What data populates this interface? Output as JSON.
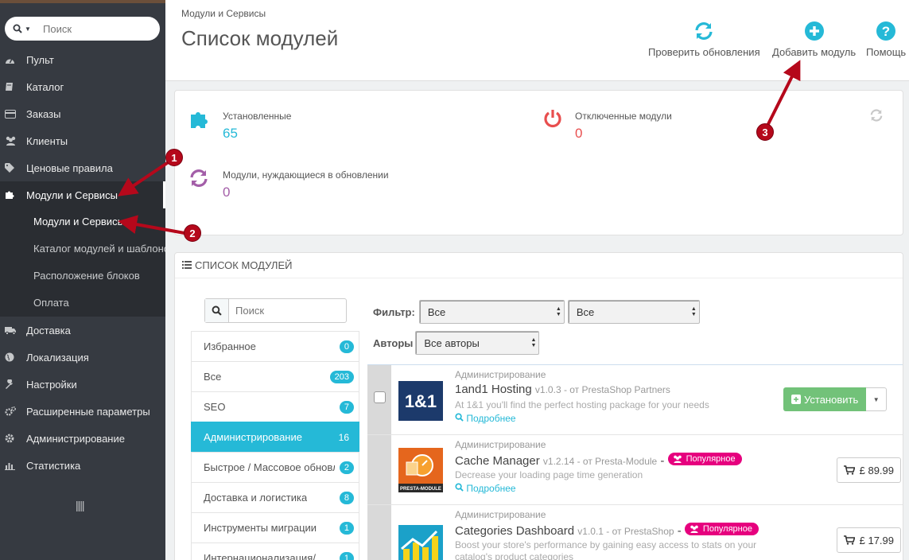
{
  "sidebar": {
    "search_placeholder": "Поиск",
    "items": [
      {
        "label": "Пульт",
        "icon": "dashboard-icon"
      },
      {
        "label": "Каталог",
        "icon": "book-icon"
      },
      {
        "label": "Заказы",
        "icon": "credit-card-icon"
      },
      {
        "label": "Клиенты",
        "icon": "users-icon"
      },
      {
        "label": "Ценовые правила",
        "icon": "tags-icon"
      },
      {
        "label": "Модули и Сервисы",
        "icon": "puzzle-icon"
      }
    ],
    "sub_items": [
      {
        "label": "Модули и Сервисы"
      },
      {
        "label": "Каталог модулей и шаблонов"
      },
      {
        "label": "Расположение блоков"
      },
      {
        "label": "Оплата"
      }
    ],
    "items_after": [
      {
        "label": "Доставка",
        "icon": "truck-icon"
      },
      {
        "label": "Локализация",
        "icon": "globe-icon"
      },
      {
        "label": "Настройки",
        "icon": "wrench-icon"
      },
      {
        "label": "Расширенные параметры",
        "icon": "cogs-icon"
      },
      {
        "label": "Администрирование",
        "icon": "gear-icon"
      },
      {
        "label": "Статистика",
        "icon": "bar-chart-icon"
      }
    ]
  },
  "header": {
    "breadcrumb": "Модули и Сервисы",
    "title": "Список модулей",
    "toolbar": {
      "check_updates": "Проверить обновления",
      "add_module": "Добавить модуль",
      "help": "Помощь"
    }
  },
  "stats": {
    "installed_label": "Установленные",
    "installed_value": "65",
    "disabled_label": "Отключенные модули",
    "disabled_value": "0",
    "updates_label": "Модули, нуждающиеся в обновлении",
    "updates_value": "0"
  },
  "modules_panel": {
    "heading": "Список модулей",
    "search_placeholder": "Поиск",
    "categories": [
      {
        "label": "Избранное",
        "count": "0"
      },
      {
        "label": "Все",
        "count": "203"
      },
      {
        "label": "SEO",
        "count": "7"
      },
      {
        "label": "Администрирование",
        "count": "16"
      },
      {
        "label": "Быстрое / Массовое обновление",
        "count": "2"
      },
      {
        "label": "Доставка и логистика",
        "count": "8"
      },
      {
        "label": "Инструменты миграции",
        "count": "1"
      },
      {
        "label": "Интернационализация/",
        "count": "1"
      }
    ],
    "filter_label": "Фильтр:",
    "filter_value_1": "Все",
    "filter_value_2": "Все",
    "authors_label": "Авторы",
    "authors_value": "Все авторы",
    "modules": [
      {
        "category": "Администрирование",
        "name": "1and1 Hosting",
        "version": "v1.0.3 - от PrestaShop Partners",
        "desc": "At 1&1 you'll find the perfect hosting package for your needs",
        "more": "Подробнее",
        "action": "Установить",
        "logo_text": "1&1"
      },
      {
        "category": "Администрирование",
        "name": "Cache Manager",
        "version": "v1.2.14 - от Presta-Module",
        "sep": "-",
        "badge": "Популярное",
        "desc": "Decrease your loading page time generation",
        "more": "Подробнее",
        "price": "£ 89.99",
        "logo_text": "PRESTA-MODULE"
      },
      {
        "category": "Администрирование",
        "name": "Categories Dashboard",
        "version": "v1.0.1 - от PrestaShop",
        "sep": "-",
        "badge": "Популярное",
        "desc": "Boost your store's performance by gaining easy access to stats on your catalog's product categories",
        "price": "£ 17.99"
      }
    ]
  },
  "annotations": [
    "1",
    "2",
    "3"
  ],
  "colors": {
    "sidebar_bg": "#363a41",
    "accent": "#25b9d7",
    "disabled": "#e84e4e",
    "updates": "#a35ea8",
    "install": "#72c279",
    "popular": "#e6007e",
    "annotation": "#b5081b"
  }
}
